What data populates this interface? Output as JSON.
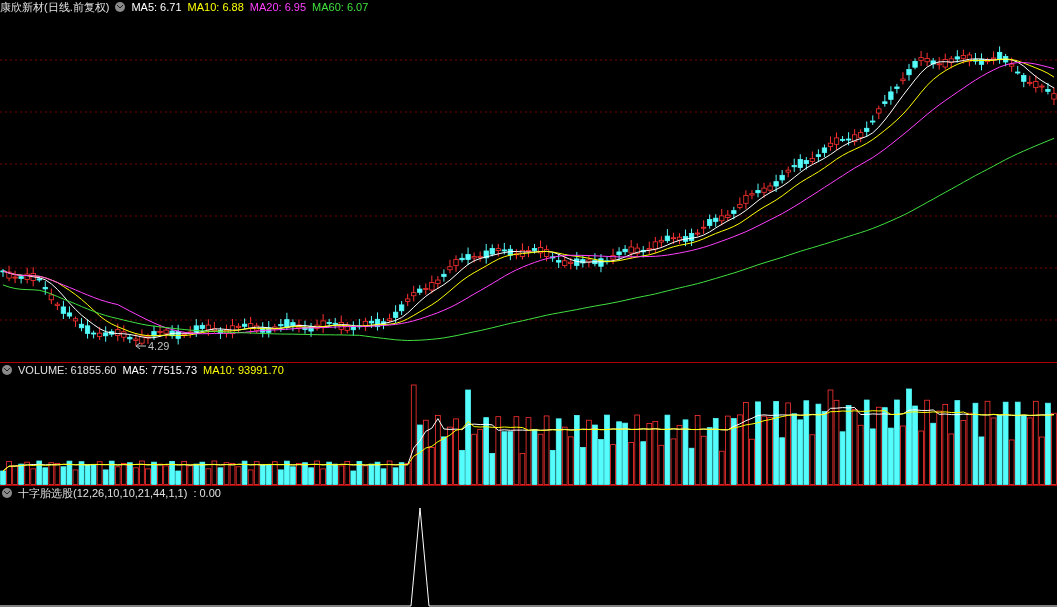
{
  "panels": [
    {
      "kind": "candlestick",
      "title": "康欣新材(日线.前复权)",
      "legend": [
        {
          "label": "MA5: 6.71",
          "color": "#ffffff"
        },
        {
          "label": "MA10: 6.88",
          "color": "#ffff00"
        },
        {
          "label": "MA20: 6.95",
          "color": "#ff40ff"
        },
        {
          "label": "MA60: 6.07",
          "color": "#40e040"
        }
      ],
      "low_marker": "4.29"
    },
    {
      "kind": "volume",
      "title": "VOLUME: 61855.60",
      "legend": [
        {
          "label": "MA5: 77515.73",
          "color": "#ffffff"
        },
        {
          "label": "MA10: 93991.70",
          "color": "#ffff00"
        }
      ]
    },
    {
      "kind": "indicator",
      "title": "十字胎选股(12,26,10,10,21,44,1,1)",
      "legend": [
        {
          "label": ": 0.00"
        }
      ]
    }
  ]
}
